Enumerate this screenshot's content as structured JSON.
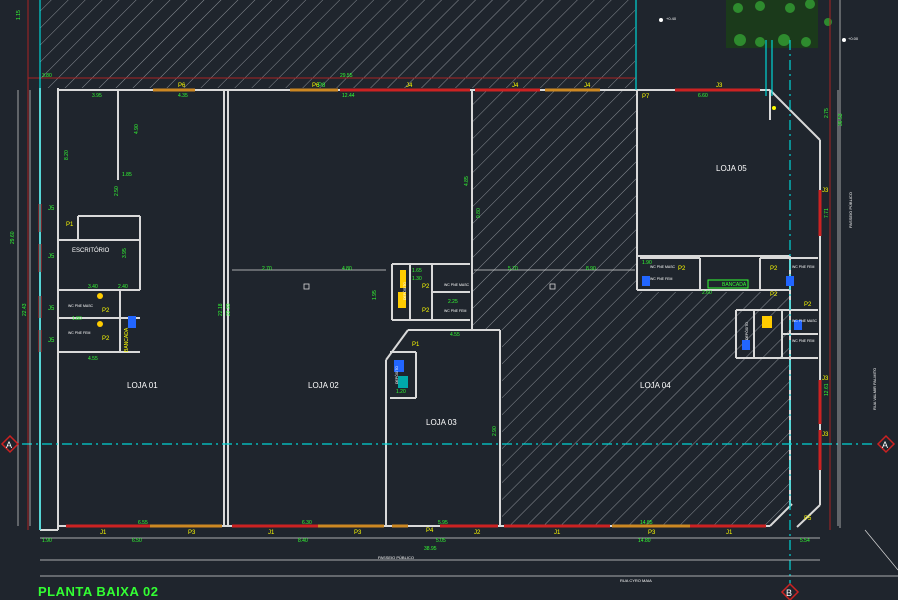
{
  "title": "PLANTA BAIXA 02",
  "rooms": {
    "loja01": "LOJA 01",
    "loja02": "LOJA 02",
    "loja03": "LOJA  03",
    "loja04": "LOJA 04",
    "loja05": "LOJA 05",
    "escritorio": "ESCRITÓRIO",
    "bancada_left": "BANCADA",
    "bancada_right": "BANCADA"
  },
  "streets": {
    "passeio_bottom": "PASSEIO PÚBLICO",
    "rua_cyro": "RUA CYRO MAIA",
    "passeio_right": "PASSEIO PÚBLICO",
    "rua_right": "RUA VALMIR PALMITO"
  },
  "sections": {
    "a_left": "A",
    "a_right": "A",
    "b_bottom": "B"
  },
  "levels": {
    "top": "+0.40",
    "right": "+0.00"
  },
  "openings": {
    "p1_left": "P1",
    "j5_a": "J5",
    "j5_b": "J5",
    "j5_c": "J5",
    "j5_d": "J5",
    "p2_a": "P2",
    "p2_b": "P2",
    "p2_c": "P2",
    "p2_d": "P2",
    "p2_e": "P2",
    "p2_f": "P2",
    "p2_g": "P2",
    "p2_h": "P2",
    "p1_mid": "P1",
    "p7": "P7",
    "p5": "P5",
    "p6_a": "P6",
    "p6_b": "P6",
    "j4_a": "J4",
    "j4_b": "J4",
    "j4_c": "J4",
    "j4_bottom": "J4",
    "j3_top": "J3",
    "j3_a": "J3",
    "j3_b": "J3",
    "j3_c": "J3",
    "j1_a": "J1",
    "j1_b": "J1",
    "j1_c": "J1",
    "j1_d": "J1",
    "p3_a": "P3",
    "p3_b": "P3",
    "p3_c": "P3",
    "p4": "P4",
    "j2": "J2",
    "p8": "P8"
  },
  "toilets": {
    "wc_a": "WC PNE MASC",
    "wc_b": "WC PNE FEM",
    "wc_c": "WC PNE MASC",
    "wc_d": "WC PNE FEM",
    "wc_e": "WC PNE MASC",
    "wc_f": "WC PNE FEM",
    "wc_g": "WC PNE FEM",
    "dep_a": "DEPÓSITO",
    "dep_b": "DEPÓSITO",
    "dep_c": "DEPÓSITO",
    "wc_h": "WC PNE MASC",
    "wc_i": "WC PNE FEM"
  },
  "dims": {
    "d1": "1.15",
    "d2": "3.80",
    "d3": "12.44",
    "d4": "4.35",
    "d5": "29.55",
    "d6": "6.60",
    "d7": "2.75",
    "d8": "36.53",
    "d9": "8.20",
    "d10": "3.95",
    "d11": "22.43",
    "d12": "29.60",
    "d13": "4.90",
    "d14": "3.95",
    "d15": "4.80",
    "d16": "2.50",
    "d17": "22.18",
    "d18": "22.33",
    "d19": "4.85",
    "d20": "9.80",
    "d21": "2.90",
    "d22": "7.71",
    "d23": "12.61",
    "d24": "6.55",
    "d25": "5.95",
    "d26": "14.85",
    "d27": "6.30",
    "d28": "1.90",
    "d29": "6.50",
    "d30": "8.40",
    "d31": "5.05",
    "d32": "38.95",
    "d33": "14.80",
    "d34": "5.54",
    "d35": "2.70",
    "d36": "1.65",
    "d37": "1.90",
    "d38": "1.95",
    "d39": "1.80",
    "d40": "3.40",
    "d41": "2.40",
    "d42": "1.30",
    "d43": "4.55",
    "d44": "2.60",
    "d45": "8.90",
    "d46": "4.55",
    "d47": "5.70",
    "d48": "1.85",
    "d49": "2.25",
    "d50": "1.20"
  },
  "colors": {
    "background": "#1f252d",
    "wall": "#d9d9d9",
    "door": "#cc2222",
    "window": "#cc8822",
    "text_green": "#33ff33",
    "text_yellow": "#ffff00",
    "text_white": "#ffffff",
    "axis_cyan": "#00d4d4",
    "hatch": "#8a8f96",
    "grid_red": "#aa2222"
  }
}
